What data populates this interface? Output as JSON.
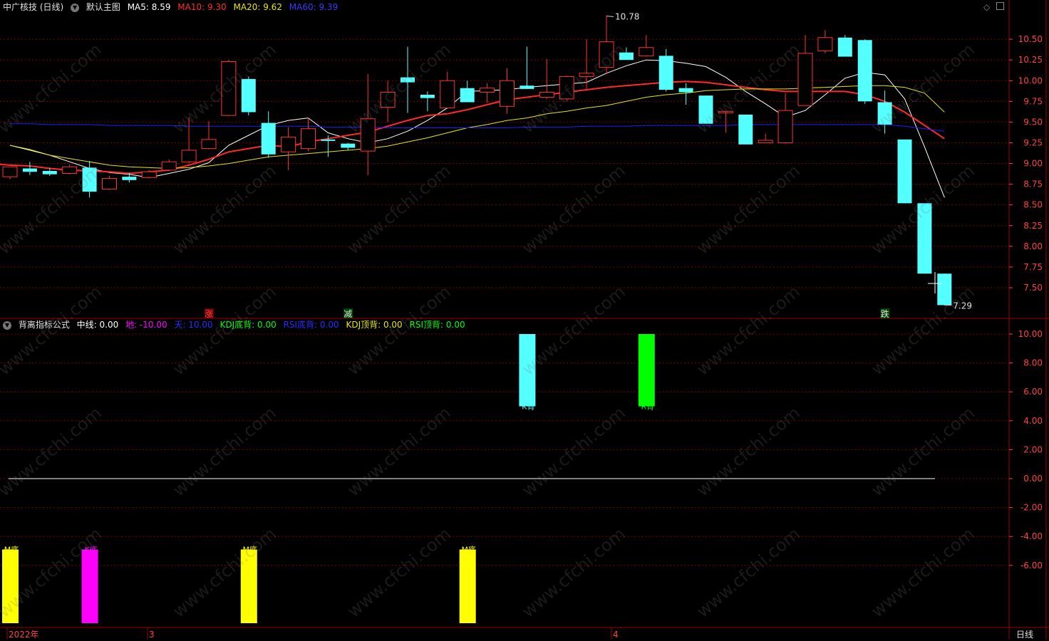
{
  "main_header": {
    "stock": "中广核技 (日线)",
    "template": "默认主图",
    "ma5_label": "MA5: 8.59",
    "ma10_label": "MA10: 9.30",
    "ma20_label": "MA20: 9.62",
    "ma60_label": "MA60: 9.39"
  },
  "sub_header": {
    "formula": "背离指标公式",
    "mid": "中线: 0.00",
    "di": "地: -10.00",
    "tian": "天: 10.00",
    "kdj_bottom": "KDJ底背: 0.00",
    "rsi_bottom": "RSI底背: 0.00",
    "kdj_top": "KDJ顶背: 0.00",
    "rsi_top": "RSI顶背: 0.00"
  },
  "colors": {
    "up": "#ff3232",
    "down": "#54ffff",
    "ma5": "#ffffff",
    "ma10": "#ff2a2a",
    "ma20": "#e6e600",
    "ma60": "#1f1fff",
    "grid": "#7a0000",
    "axis_text": "#ff4040",
    "magenta": "#ff00ff",
    "yellow": "#ffff00",
    "green": "#00ff00"
  },
  "watermark_text": "www.cfchi.com",
  "bottom_bar": {
    "period": "日线"
  },
  "chart_data": [
    {
      "type": "candlestick",
      "ylim": [
        7.2,
        10.78
      ],
      "yticks": [
        7.5,
        7.75,
        8.0,
        8.25,
        8.5,
        8.75,
        9.0,
        9.25,
        9.5,
        9.75,
        10.0,
        10.25,
        10.5
      ],
      "xlabels": [
        "2022年",
        "3",
        "4"
      ],
      "annotations": {
        "high": "10.78",
        "low": "7.29"
      },
      "markers": [
        "涨",
        "减",
        "跌"
      ],
      "candles": [
        {
          "o": 8.84,
          "h": 8.96,
          "l": 8.81,
          "c": 8.96
        },
        {
          "o": 8.94,
          "h": 9.02,
          "l": 8.86,
          "c": 8.9
        },
        {
          "o": 8.91,
          "h": 8.95,
          "l": 8.85,
          "c": 8.87
        },
        {
          "o": 8.88,
          "h": 8.99,
          "l": 8.87,
          "c": 8.96
        },
        {
          "o": 8.95,
          "h": 9.03,
          "l": 8.59,
          "c": 8.66
        },
        {
          "o": 8.69,
          "h": 8.85,
          "l": 8.68,
          "c": 8.82
        },
        {
          "o": 8.84,
          "h": 8.89,
          "l": 8.77,
          "c": 8.8
        },
        {
          "o": 8.83,
          "h": 8.92,
          "l": 8.82,
          "c": 8.9
        },
        {
          "o": 8.92,
          "h": 9.05,
          "l": 8.91,
          "c": 9.02
        },
        {
          "o": 9.02,
          "h": 9.56,
          "l": 9.0,
          "c": 9.16
        },
        {
          "o": 9.18,
          "h": 9.51,
          "l": 9.17,
          "c": 9.29
        },
        {
          "o": 9.58,
          "h": 10.25,
          "l": 9.57,
          "c": 10.23
        },
        {
          "o": 10.02,
          "h": 10.05,
          "l": 9.58,
          "c": 9.62
        },
        {
          "o": 9.49,
          "h": 9.63,
          "l": 9.07,
          "c": 9.11
        },
        {
          "o": 9.14,
          "h": 9.44,
          "l": 8.92,
          "c": 9.32
        },
        {
          "o": 9.18,
          "h": 9.55,
          "l": 9.15,
          "c": 9.42
        },
        {
          "o": 9.29,
          "h": 9.34,
          "l": 9.08,
          "c": 9.28
        },
        {
          "o": 9.24,
          "h": 9.25,
          "l": 9.16,
          "c": 9.19
        },
        {
          "o": 9.15,
          "h": 10.08,
          "l": 8.86,
          "c": 9.54
        },
        {
          "o": 9.68,
          "h": 10.0,
          "l": 9.5,
          "c": 9.86
        },
        {
          "o": 10.04,
          "h": 10.41,
          "l": 9.61,
          "c": 9.98
        },
        {
          "o": 9.83,
          "h": 9.87,
          "l": 9.63,
          "c": 9.79
        },
        {
          "o": 9.67,
          "h": 10.11,
          "l": 9.66,
          "c": 10.0
        },
        {
          "o": 9.91,
          "h": 10.0,
          "l": 9.84,
          "c": 9.74
        },
        {
          "o": 9.86,
          "h": 9.97,
          "l": 9.73,
          "c": 9.91
        },
        {
          "o": 9.69,
          "h": 10.15,
          "l": 9.6,
          "c": 10.0
        },
        {
          "o": 9.94,
          "h": 10.41,
          "l": 9.92,
          "c": 9.9
        },
        {
          "o": 9.8,
          "h": 10.26,
          "l": 9.78,
          "c": 9.86
        },
        {
          "o": 9.78,
          "h": 10.06,
          "l": 9.76,
          "c": 10.05
        },
        {
          "o": 10.05,
          "h": 10.5,
          "l": 9.9,
          "c": 10.09
        },
        {
          "o": 10.16,
          "h": 10.78,
          "l": 10.08,
          "c": 10.47
        },
        {
          "o": 10.34,
          "h": 10.4,
          "l": 10.25,
          "c": 10.25
        },
        {
          "o": 10.3,
          "h": 10.55,
          "l": 10.29,
          "c": 10.4
        },
        {
          "o": 10.3,
          "h": 10.38,
          "l": 9.87,
          "c": 9.89
        },
        {
          "o": 9.91,
          "h": 9.97,
          "l": 9.71,
          "c": 9.86
        },
        {
          "o": 9.82,
          "h": 9.82,
          "l": 9.49,
          "c": 9.48
        },
        {
          "o": 9.63,
          "h": 9.63,
          "l": 9.37,
          "c": 9.63
        },
        {
          "o": 9.59,
          "h": 9.59,
          "l": 9.23,
          "c": 9.23
        },
        {
          "o": 9.25,
          "h": 9.36,
          "l": 9.25,
          "c": 9.28
        },
        {
          "o": 9.25,
          "h": 9.85,
          "l": 9.24,
          "c": 9.64
        },
        {
          "o": 9.7,
          "h": 10.55,
          "l": 9.7,
          "c": 10.33
        },
        {
          "o": 10.36,
          "h": 10.61,
          "l": 10.33,
          "c": 10.52
        },
        {
          "o": 10.52,
          "h": 10.55,
          "l": 10.29,
          "c": 10.29
        },
        {
          "o": 10.49,
          "h": 10.5,
          "l": 9.72,
          "c": 9.75
        },
        {
          "o": 9.74,
          "h": 9.88,
          "l": 9.36,
          "c": 9.47
        },
        {
          "o": 9.29,
          "h": 9.29,
          "l": 8.52,
          "c": 8.52
        },
        {
          "o": 8.52,
          "h": 8.52,
          "l": 7.67,
          "c": 7.67
        },
        {
          "o": 7.67,
          "h": 7.67,
          "l": 7.29,
          "c": 7.29
        }
      ],
      "series": [
        {
          "name": "MA5",
          "values": [
            9.22,
            9.16,
            9.1,
            9.02,
            8.94,
            8.89,
            8.87,
            8.83,
            8.88,
            8.93,
            9.01,
            9.22,
            9.34,
            9.46,
            9.52,
            9.55,
            9.37,
            9.3,
            9.25,
            9.3,
            9.39,
            9.52,
            9.67,
            9.87,
            9.88,
            9.89,
            9.92,
            9.94,
            9.96,
            9.98,
            10.09,
            10.18,
            10.25,
            10.24,
            10.21,
            10.17,
            10.04,
            9.87,
            9.72,
            9.56,
            9.64,
            9.83,
            10.03,
            10.1,
            10.07,
            9.78,
            9.2,
            8.59
          ]
        },
        {
          "name": "MA10",
          "values": [
            9.0,
            9.0,
            8.98,
            8.97,
            8.94,
            8.92,
            8.91,
            8.9,
            8.88,
            8.9,
            8.92,
            8.98,
            9.05,
            9.14,
            9.18,
            9.22,
            9.2,
            9.26,
            9.3,
            9.34,
            9.38,
            9.45,
            9.52,
            9.58,
            9.6,
            9.65,
            9.71,
            9.77,
            9.8,
            9.83,
            9.86,
            9.89,
            9.92,
            9.94,
            9.96,
            9.98,
            9.99,
            9.98,
            9.95,
            9.92,
            9.89,
            9.87,
            9.87,
            9.87,
            9.87,
            9.83,
            9.75,
            9.62,
            9.46,
            9.3
          ]
        },
        {
          "name": "MA20",
          "values": [
            9.22,
            9.17,
            9.1,
            9.06,
            9.02,
            8.98,
            8.96,
            8.95,
            8.94,
            8.95,
            8.97,
            9.0,
            9.04,
            9.08,
            9.1,
            9.12,
            9.14,
            9.16,
            9.18,
            9.21,
            9.26,
            9.31,
            9.37,
            9.43,
            9.47,
            9.52,
            9.55,
            9.6,
            9.63,
            9.67,
            9.7,
            9.75,
            9.8,
            9.83,
            9.85,
            9.88,
            9.89,
            9.9,
            9.9,
            9.9,
            9.91,
            9.92,
            9.93,
            9.94,
            9.94,
            9.92,
            9.85,
            9.62
          ]
        },
        {
          "name": "MA60",
          "values": [
            9.48,
            9.48,
            9.47,
            9.47,
            9.47,
            9.46,
            9.46,
            9.46,
            9.46,
            9.45,
            9.45,
            9.45,
            9.45,
            9.45,
            9.45,
            9.45,
            9.44,
            9.44,
            9.44,
            9.43,
            9.43,
            9.43,
            9.43,
            9.43,
            9.43,
            9.43,
            9.44,
            9.44,
            9.44,
            9.45,
            9.45,
            9.45,
            9.46,
            9.46,
            9.46,
            9.46,
            9.46,
            9.47,
            9.47,
            9.47,
            9.47,
            9.47,
            9.47,
            9.47,
            9.47,
            9.45,
            9.42,
            9.39
          ]
        }
      ]
    },
    {
      "type": "bar",
      "ylim": [
        -10,
        10
      ],
      "yticks": [
        10.0,
        8.0,
        6.0,
        4.0,
        2.0,
        0.0,
        -2.0,
        -4.0,
        -6.0
      ],
      "zero_line": 0,
      "bars": [
        {
          "index": 0,
          "from": -10,
          "to": -4.9,
          "label": "M底",
          "color": "#ffff00"
        },
        {
          "index": 4,
          "from": -10,
          "to": -4.9,
          "label": "K底",
          "color": "#ff00ff"
        },
        {
          "index": 12,
          "from": -10,
          "to": -4.9,
          "label": "M底",
          "color": "#ffff00"
        },
        {
          "index": 23,
          "from": -10,
          "to": -4.9,
          "label": "M底",
          "color": "#ffff00"
        },
        {
          "index": 26,
          "from": 10,
          "to": 5.0,
          "label": "K背",
          "color": "#54ffff"
        },
        {
          "index": 32,
          "from": 10,
          "to": 5.0,
          "label": "R背",
          "color": "#00ff00"
        }
      ]
    }
  ]
}
